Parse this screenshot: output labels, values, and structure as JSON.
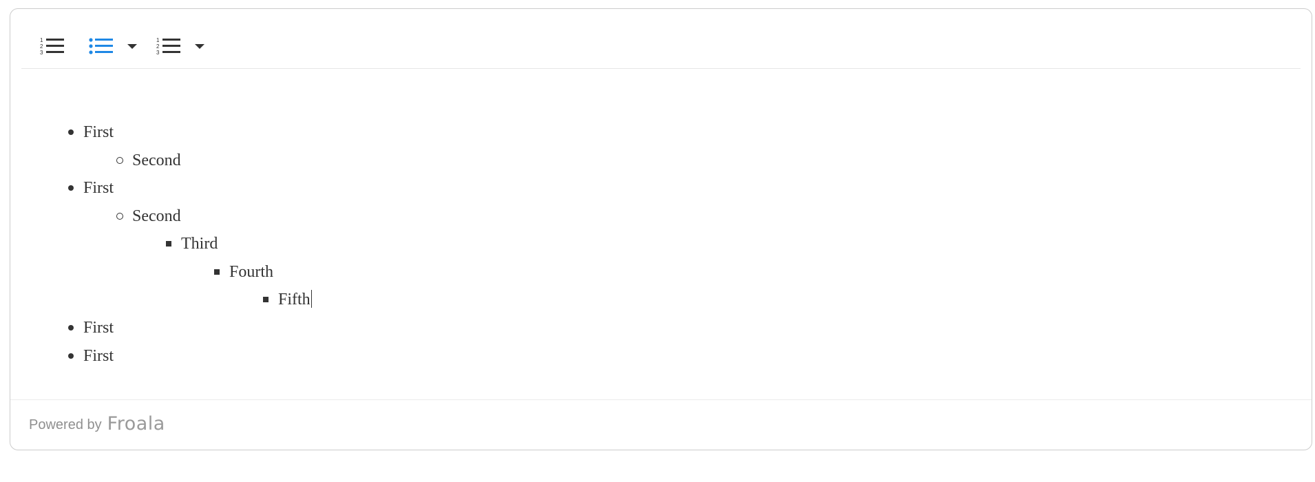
{
  "toolbar": {
    "buttons": [
      {
        "name": "ordered-list",
        "icon": "ordered-list-icon",
        "active": false,
        "dropdown": false
      },
      {
        "name": "unordered-list",
        "icon": "unordered-list-icon",
        "active": true,
        "dropdown": true
      },
      {
        "name": "ordered-list-options",
        "icon": "ordered-list-icon",
        "active": false,
        "dropdown": true
      }
    ],
    "active_color": "#1e88e5",
    "icon_color": "#333333"
  },
  "content": {
    "items": [
      {
        "text": "First",
        "level": 1,
        "marker": "disc"
      },
      {
        "text": "Second",
        "level": 2,
        "marker": "circle"
      },
      {
        "text": "First",
        "level": 1,
        "marker": "disc"
      },
      {
        "text": "Second",
        "level": 2,
        "marker": "circle"
      },
      {
        "text": "Third",
        "level": 3,
        "marker": "square"
      },
      {
        "text": "Fourth",
        "level": 4,
        "marker": "square"
      },
      {
        "text": "Fifth",
        "level": 5,
        "marker": "square"
      },
      {
        "text": "First",
        "level": 1,
        "marker": "disc"
      },
      {
        "text": "First",
        "level": 1,
        "marker": "disc"
      }
    ]
  },
  "footer": {
    "powered_by": "Powered by",
    "brand": "Froala"
  }
}
